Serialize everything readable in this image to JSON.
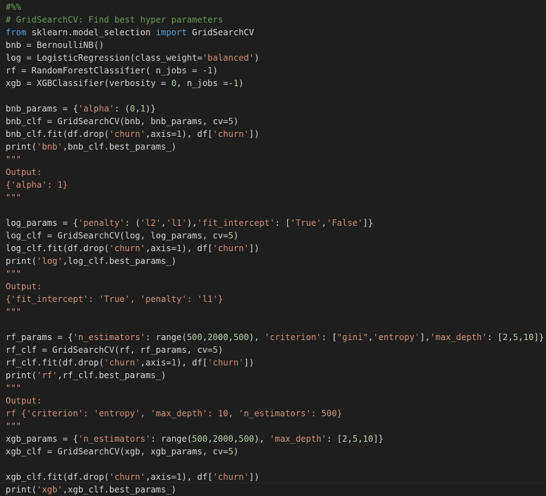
{
  "colors": {
    "background": "#1e1e1e",
    "plain": "#d4d4d4",
    "comment": "#6a9955",
    "keyword": "#569cd6",
    "string": "#ce9178",
    "number": "#b5cea8"
  },
  "editor": {
    "lines": [
      [
        {
          "t": "#%%",
          "k": "comment"
        }
      ],
      [
        {
          "t": "# GridSearchCV: Find best hyper parameters",
          "k": "comment"
        }
      ],
      [
        {
          "t": "from",
          "k": "keyword"
        },
        {
          "t": " sklearn.model_selection ",
          "k": "plain"
        },
        {
          "t": "import",
          "k": "keyword"
        },
        {
          "t": " GridSearchCV",
          "k": "plain"
        }
      ],
      [
        {
          "t": "bnb = BernoulliNB()",
          "k": "plain"
        }
      ],
      [
        {
          "t": "log = LogisticRegression(class_weight=",
          "k": "plain"
        },
        {
          "t": "'balanced'",
          "k": "string"
        },
        {
          "t": ")",
          "k": "plain"
        }
      ],
      [
        {
          "t": "rf = RandomForestClassifier( n_jobs = ",
          "k": "plain"
        },
        {
          "t": "-1",
          "k": "number"
        },
        {
          "t": ")",
          "k": "plain"
        }
      ],
      [
        {
          "t": "xgb = XGBClassifier(verbosity = ",
          "k": "plain"
        },
        {
          "t": "0",
          "k": "number"
        },
        {
          "t": ", n_jobs =",
          "k": "plain"
        },
        {
          "t": "-1",
          "k": "number"
        },
        {
          "t": ")",
          "k": "plain"
        }
      ],
      [],
      [
        {
          "t": "bnb_params = {",
          "k": "plain"
        },
        {
          "t": "'alpha'",
          "k": "string"
        },
        {
          "t": ": (",
          "k": "plain"
        },
        {
          "t": "0",
          "k": "number"
        },
        {
          "t": ",",
          "k": "plain"
        },
        {
          "t": "1",
          "k": "number"
        },
        {
          "t": ")}",
          "k": "plain"
        }
      ],
      [
        {
          "t": "bnb_clf = GridSearchCV(bnb, bnb_params, cv=",
          "k": "plain"
        },
        {
          "t": "5",
          "k": "number"
        },
        {
          "t": ")",
          "k": "plain"
        }
      ],
      [
        {
          "t": "bnb_clf.fit(df.drop(",
          "k": "plain"
        },
        {
          "t": "'churn'",
          "k": "string"
        },
        {
          "t": ",axis=",
          "k": "plain"
        },
        {
          "t": "1",
          "k": "number"
        },
        {
          "t": "), df[",
          "k": "plain"
        },
        {
          "t": "'churn'",
          "k": "string"
        },
        {
          "t": "])",
          "k": "plain"
        }
      ],
      [
        {
          "t": "print(",
          "k": "plain"
        },
        {
          "t": "'bnb'",
          "k": "string"
        },
        {
          "t": ",bnb_clf.best_params_)",
          "k": "plain"
        }
      ],
      [
        {
          "t": "\"\"\"",
          "k": "doc"
        }
      ],
      [
        {
          "t": "Output:",
          "k": "doc"
        }
      ],
      [
        {
          "t": "{'alpha': 1}",
          "k": "doc"
        }
      ],
      [
        {
          "t": "\"\"\"",
          "k": "doc"
        }
      ],
      [],
      [
        {
          "t": "log_params = {",
          "k": "plain"
        },
        {
          "t": "'penalty'",
          "k": "string"
        },
        {
          "t": ": (",
          "k": "plain"
        },
        {
          "t": "'l2'",
          "k": "string"
        },
        {
          "t": ",",
          "k": "plain"
        },
        {
          "t": "'l1'",
          "k": "string"
        },
        {
          "t": "),",
          "k": "plain"
        },
        {
          "t": "'fit_intercept'",
          "k": "string"
        },
        {
          "t": ": [",
          "k": "plain"
        },
        {
          "t": "'True'",
          "k": "string"
        },
        {
          "t": ",",
          "k": "plain"
        },
        {
          "t": "'False'",
          "k": "string"
        },
        {
          "t": "]}",
          "k": "plain"
        }
      ],
      [
        {
          "t": "log_clf = GridSearchCV(log, log_params, cv=",
          "k": "plain"
        },
        {
          "t": "5",
          "k": "number"
        },
        {
          "t": ")",
          "k": "plain"
        }
      ],
      [
        {
          "t": "log_clf.fit(df.drop(",
          "k": "plain"
        },
        {
          "t": "'churn'",
          "k": "string"
        },
        {
          "t": ",axis=",
          "k": "plain"
        },
        {
          "t": "1",
          "k": "number"
        },
        {
          "t": "), df[",
          "k": "plain"
        },
        {
          "t": "'churn'",
          "k": "string"
        },
        {
          "t": "])",
          "k": "plain"
        }
      ],
      [
        {
          "t": "print(",
          "k": "plain"
        },
        {
          "t": "'log'",
          "k": "string"
        },
        {
          "t": ",log_clf.best_params_)",
          "k": "plain"
        }
      ],
      [
        {
          "t": "\"\"\"",
          "k": "doc"
        }
      ],
      [
        {
          "t": "Output:",
          "k": "doc"
        }
      ],
      [
        {
          "t": "{'fit_intercept': 'True', 'penalty': 'l1'}",
          "k": "doc"
        }
      ],
      [
        {
          "t": "\"\"\"",
          "k": "doc"
        }
      ],
      [],
      [
        {
          "t": "rf_params = {",
          "k": "plain"
        },
        {
          "t": "'n_estimators'",
          "k": "string"
        },
        {
          "t": ": range(",
          "k": "plain"
        },
        {
          "t": "500",
          "k": "number"
        },
        {
          "t": ",",
          "k": "plain"
        },
        {
          "t": "2000",
          "k": "number"
        },
        {
          "t": ",",
          "k": "plain"
        },
        {
          "t": "500",
          "k": "number"
        },
        {
          "t": "), ",
          "k": "plain"
        },
        {
          "t": "'criterion'",
          "k": "string"
        },
        {
          "t": ": [",
          "k": "plain"
        },
        {
          "t": "\"gini\"",
          "k": "string"
        },
        {
          "t": ",",
          "k": "plain"
        },
        {
          "t": "'entropy'",
          "k": "string"
        },
        {
          "t": "],",
          "k": "plain"
        },
        {
          "t": "'max_depth'",
          "k": "string"
        },
        {
          "t": ": [",
          "k": "plain"
        },
        {
          "t": "2",
          "k": "number"
        },
        {
          "t": ",",
          "k": "plain"
        },
        {
          "t": "5",
          "k": "number"
        },
        {
          "t": ",",
          "k": "plain"
        },
        {
          "t": "10",
          "k": "number"
        },
        {
          "t": "]}",
          "k": "plain"
        }
      ],
      [
        {
          "t": "rf_clf = GridSearchCV(rf, rf_params, cv=",
          "k": "plain"
        },
        {
          "t": "5",
          "k": "number"
        },
        {
          "t": ")",
          "k": "plain"
        }
      ],
      [
        {
          "t": "rf_clf.fit(df.drop(",
          "k": "plain"
        },
        {
          "t": "'churn'",
          "k": "string"
        },
        {
          "t": ",axis=",
          "k": "plain"
        },
        {
          "t": "1",
          "k": "number"
        },
        {
          "t": "), df[",
          "k": "plain"
        },
        {
          "t": "'churn'",
          "k": "string"
        },
        {
          "t": "])",
          "k": "plain"
        }
      ],
      [
        {
          "t": "print(",
          "k": "plain"
        },
        {
          "t": "'rf'",
          "k": "string"
        },
        {
          "t": ",rf_clf.best_params_)",
          "k": "plain"
        }
      ],
      [
        {
          "t": "\"\"\"",
          "k": "doc"
        }
      ],
      [
        {
          "t": "Output:",
          "k": "doc"
        }
      ],
      [
        {
          "t": "rf {'criterion': 'entropy', 'max_depth': 10, 'n_estimators': 500}",
          "k": "doc"
        }
      ],
      [
        {
          "t": "\"\"\"",
          "k": "doc"
        }
      ],
      [
        {
          "t": "xgb_params = {",
          "k": "plain"
        },
        {
          "t": "'n_estimators'",
          "k": "string"
        },
        {
          "t": ": range(",
          "k": "plain"
        },
        {
          "t": "500",
          "k": "number"
        },
        {
          "t": ",",
          "k": "plain"
        },
        {
          "t": "2000",
          "k": "number"
        },
        {
          "t": ",",
          "k": "plain"
        },
        {
          "t": "500",
          "k": "number"
        },
        {
          "t": "), ",
          "k": "plain"
        },
        {
          "t": "'max_depth'",
          "k": "string"
        },
        {
          "t": ": [",
          "k": "plain"
        },
        {
          "t": "2",
          "k": "number"
        },
        {
          "t": ",",
          "k": "plain"
        },
        {
          "t": "5",
          "k": "number"
        },
        {
          "t": ",",
          "k": "plain"
        },
        {
          "t": "10",
          "k": "number"
        },
        {
          "t": "]}",
          "k": "plain"
        }
      ],
      [
        {
          "t": "xgb_clf = GridSearchCV(xgb, xgb_params, cv=",
          "k": "plain"
        },
        {
          "t": "5",
          "k": "number"
        },
        {
          "t": ")",
          "k": "plain"
        }
      ],
      [],
      [
        {
          "t": "xgb_clf.fit(df.drop(",
          "k": "plain"
        },
        {
          "t": "'churn'",
          "k": "string"
        },
        {
          "t": ",axis=",
          "k": "plain"
        },
        {
          "t": "1",
          "k": "number"
        },
        {
          "t": "), df[",
          "k": "plain"
        },
        {
          "t": "'churn'",
          "k": "string"
        },
        {
          "t": "])",
          "k": "plain"
        }
      ],
      [
        {
          "t": "print(",
          "k": "plain"
        },
        {
          "t": "'xgb'",
          "k": "string"
        },
        {
          "t": ",xgb_clf.best_params_)",
          "k": "plain"
        }
      ]
    ]
  }
}
